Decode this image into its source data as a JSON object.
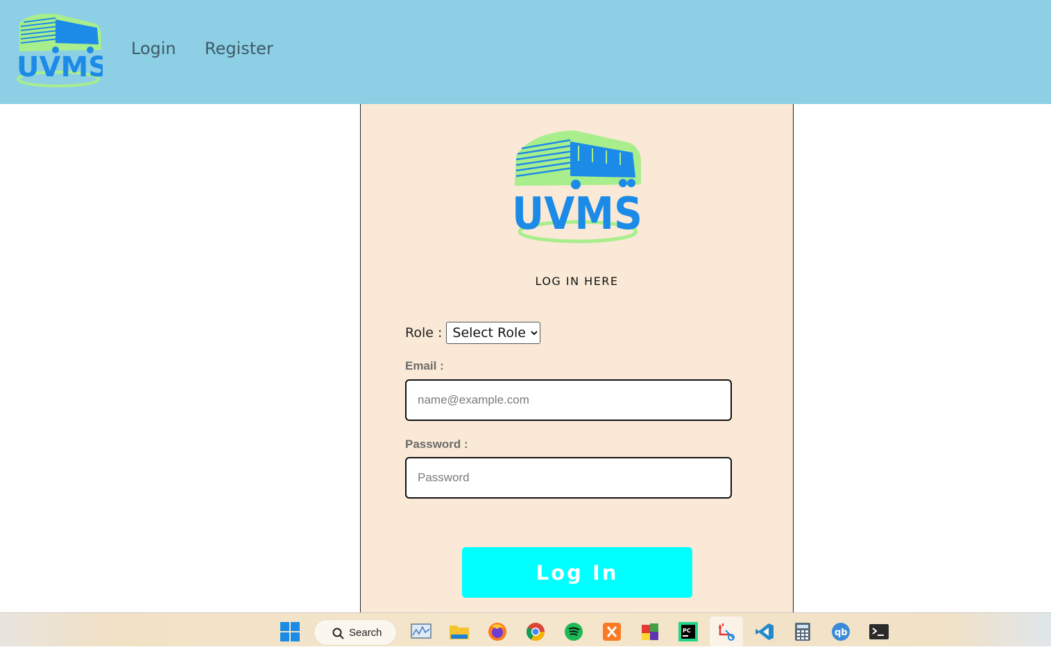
{
  "header": {
    "logo_text": "UVMS",
    "nav": [
      {
        "label": "Login"
      },
      {
        "label": "Register"
      }
    ]
  },
  "login_card": {
    "logo_text": "UVMS",
    "title": "LOG IN HERE",
    "role_label": "Role :",
    "role_selected": "Select Role",
    "email_label": "Email :",
    "email_placeholder": "name@example.com",
    "password_label": "Password :",
    "password_placeholder": "Password",
    "submit_label": "Log In"
  },
  "taskbar": {
    "search_label": "Search",
    "apps": [
      "start-icon",
      "search-icon",
      "monitor-icon",
      "file-explorer-icon",
      "firefox-icon",
      "chrome-icon",
      "spotify-icon",
      "xampp-icon",
      "app-colors-icon",
      "pycharm-icon",
      "snipping-tool-icon",
      "vscode-icon",
      "calculator-icon",
      "qbittorrent-icon",
      "terminal-icon"
    ]
  },
  "colors": {
    "header_bg": "#8dcfe5",
    "card_bg": "#f9e9d6",
    "button_bg": "#00ffff",
    "logo_blue": "#1c8be8",
    "logo_green": "#a9ee8c"
  }
}
